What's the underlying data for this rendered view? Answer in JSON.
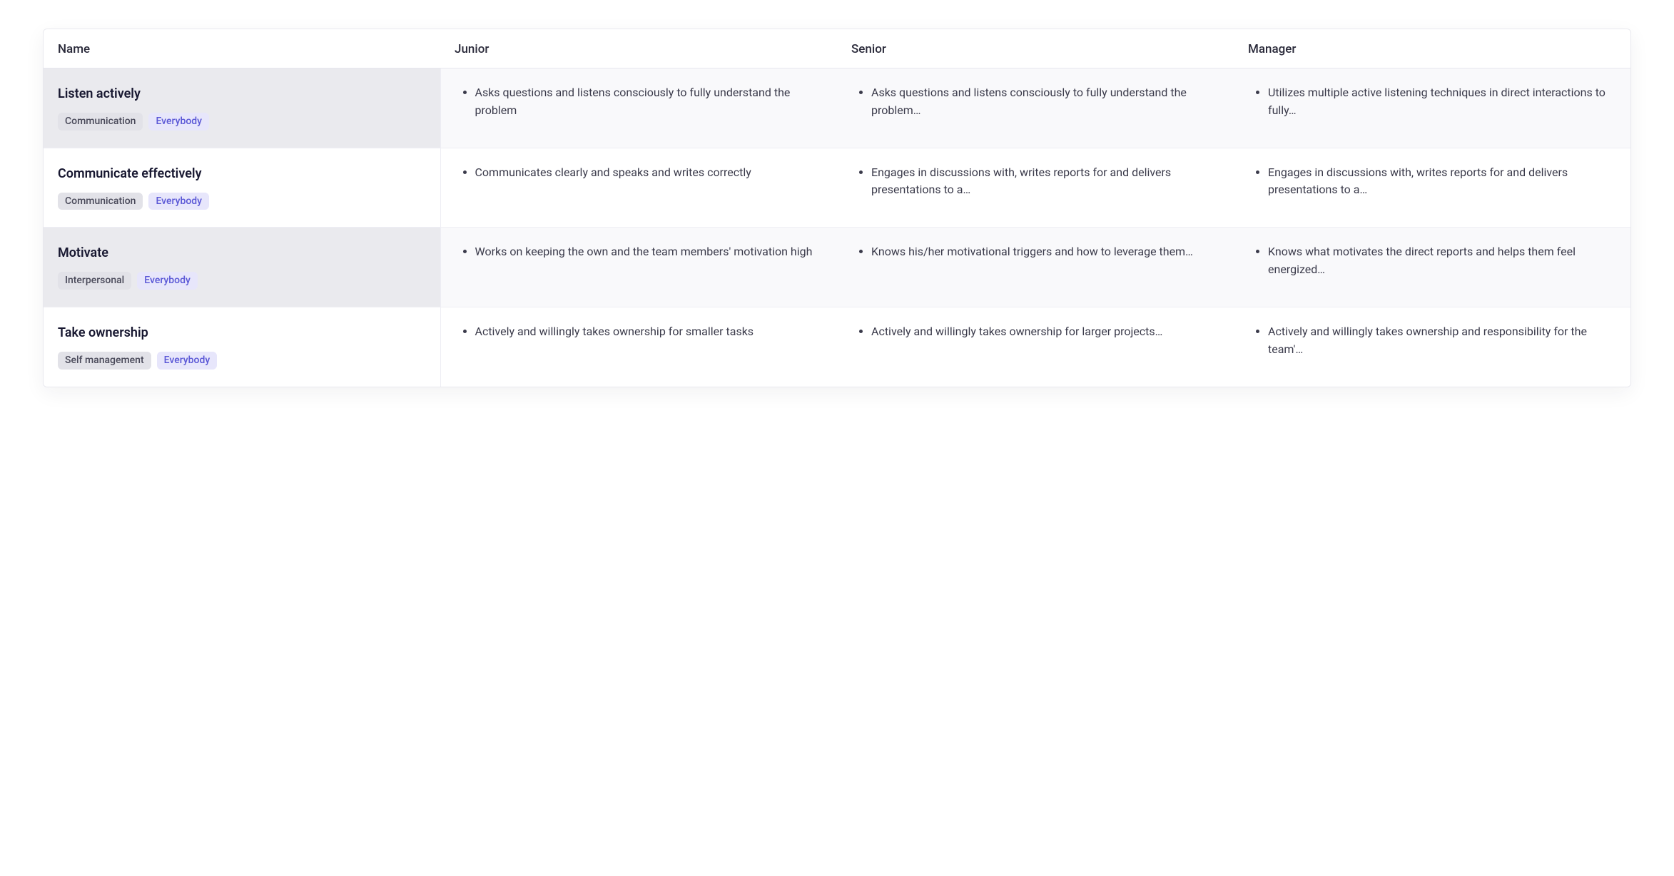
{
  "columns": {
    "name": "Name",
    "junior": "Junior",
    "senior": "Senior",
    "manager": "Manager"
  },
  "rows": [
    {
      "title": "Listen actively",
      "tags": [
        {
          "label": "Communication",
          "variant": "gray"
        },
        {
          "label": "Everybody",
          "variant": "purple"
        }
      ],
      "junior": "Asks questions and listens consciously to fully understand the problem",
      "senior": "Asks questions and listens consciously to fully understand the problem…",
      "manager": "Utilizes multiple active listening techniques in direct interactions to fully…"
    },
    {
      "title": "Communicate effectively",
      "tags": [
        {
          "label": "Communication",
          "variant": "gray"
        },
        {
          "label": "Everybody",
          "variant": "purple"
        }
      ],
      "junior": "Communicates clearly and speaks and writes correctly",
      "senior": "Engages in discussions with, writes reports for and delivers presentations to a…",
      "manager": "Engages in discussions with, writes reports for and delivers presentations to a…"
    },
    {
      "title": "Motivate",
      "tags": [
        {
          "label": "Interpersonal",
          "variant": "gray"
        },
        {
          "label": "Everybody",
          "variant": "purple"
        }
      ],
      "junior": "Works on keeping the own and the team members' motivation high",
      "senior": "Knows his/her motivational triggers and how to leverage them…",
      "manager": "Knows what motivates the direct reports and helps them feel energized…"
    },
    {
      "title": "Take ownership",
      "tags": [
        {
          "label": "Self management",
          "variant": "gray"
        },
        {
          "label": "Everybody",
          "variant": "purple"
        }
      ],
      "junior": "Actively and willingly takes ownership for smaller tasks",
      "senior": "Actively and willingly takes ownership for larger projects…",
      "manager": "Actively and willingly takes ownership and responsibility for the team'…"
    }
  ]
}
